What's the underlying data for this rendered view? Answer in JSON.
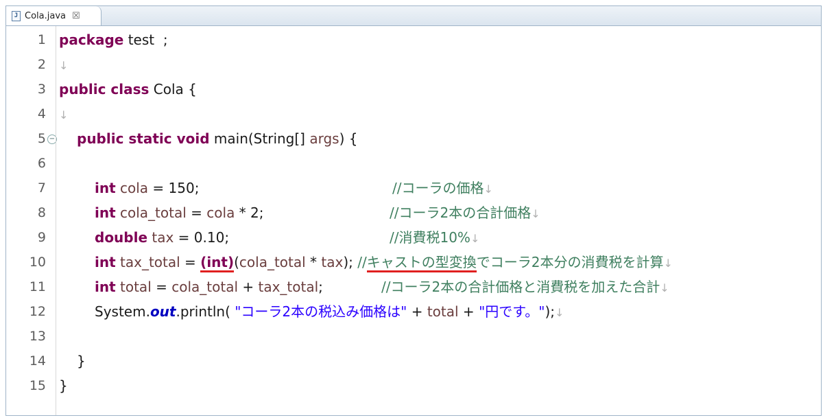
{
  "tab": {
    "title": "Cola.java",
    "file_icon": "J",
    "close": "☒"
  },
  "ws_mark": "↓",
  "lines": [
    {
      "no": "1"
    },
    {
      "no": "2"
    },
    {
      "no": "3"
    },
    {
      "no": "4"
    },
    {
      "no": "5"
    },
    {
      "no": "6"
    },
    {
      "no": "7"
    },
    {
      "no": "8"
    },
    {
      "no": "9"
    },
    {
      "no": "10"
    },
    {
      "no": "11"
    },
    {
      "no": "12"
    },
    {
      "no": "13"
    },
    {
      "no": "14"
    },
    {
      "no": "15"
    }
  ],
  "code": {
    "l1": {
      "kw": "package",
      "rest": " test  ;"
    },
    "l3": {
      "kw": "public class",
      "rest": " Cola {"
    },
    "l5": {
      "kw": "public static void",
      "rest": " main(String[] ",
      "var": "args",
      "end": ") {"
    },
    "l7": {
      "kw": "int",
      "var": " cola",
      "rest": " = 150;",
      "comment": "//コーラの価格"
    },
    "l8": {
      "kw": "int",
      "var": " cola_total",
      "rest": " = ",
      "var2": "cola",
      "rest2": " * 2;",
      "comment": "//コーラ2本の合計価格"
    },
    "l9": {
      "kw": "double",
      "var": " tax",
      "rest": " = 0.10;",
      "comment": "//消費税10%"
    },
    "l10": {
      "kw": "int",
      "var": " tax_total",
      "rest": " = ",
      "cast": "(int)",
      "rest2": "(",
      "var2": "cola_total",
      "rest3": " * ",
      "var3": "tax",
      "rest4": ");",
      "comment_a": "//",
      "comment_b": "キャストの型変換",
      "comment_c": "でコーラ2本分の消費税を計算"
    },
    "l11": {
      "kw": "int",
      "var": " total",
      "rest": " = ",
      "var2": "cola_total",
      "rest2": " + ",
      "var3": "tax_total",
      "rest3": ";",
      "comment": "//コーラ2本の合計価格と消費税を加えた合計"
    },
    "l12": {
      "pre": "System.",
      "out": "out",
      "mid": ".println( ",
      "str1": "\"コーラ2本の税込み価格は\"",
      "plus1": " + ",
      "var": "total",
      "plus2": " + ",
      "str2": "\"円です。\"",
      "end": ");"
    },
    "l14": {
      "rest": "}"
    },
    "l15": {
      "rest": "}"
    }
  }
}
